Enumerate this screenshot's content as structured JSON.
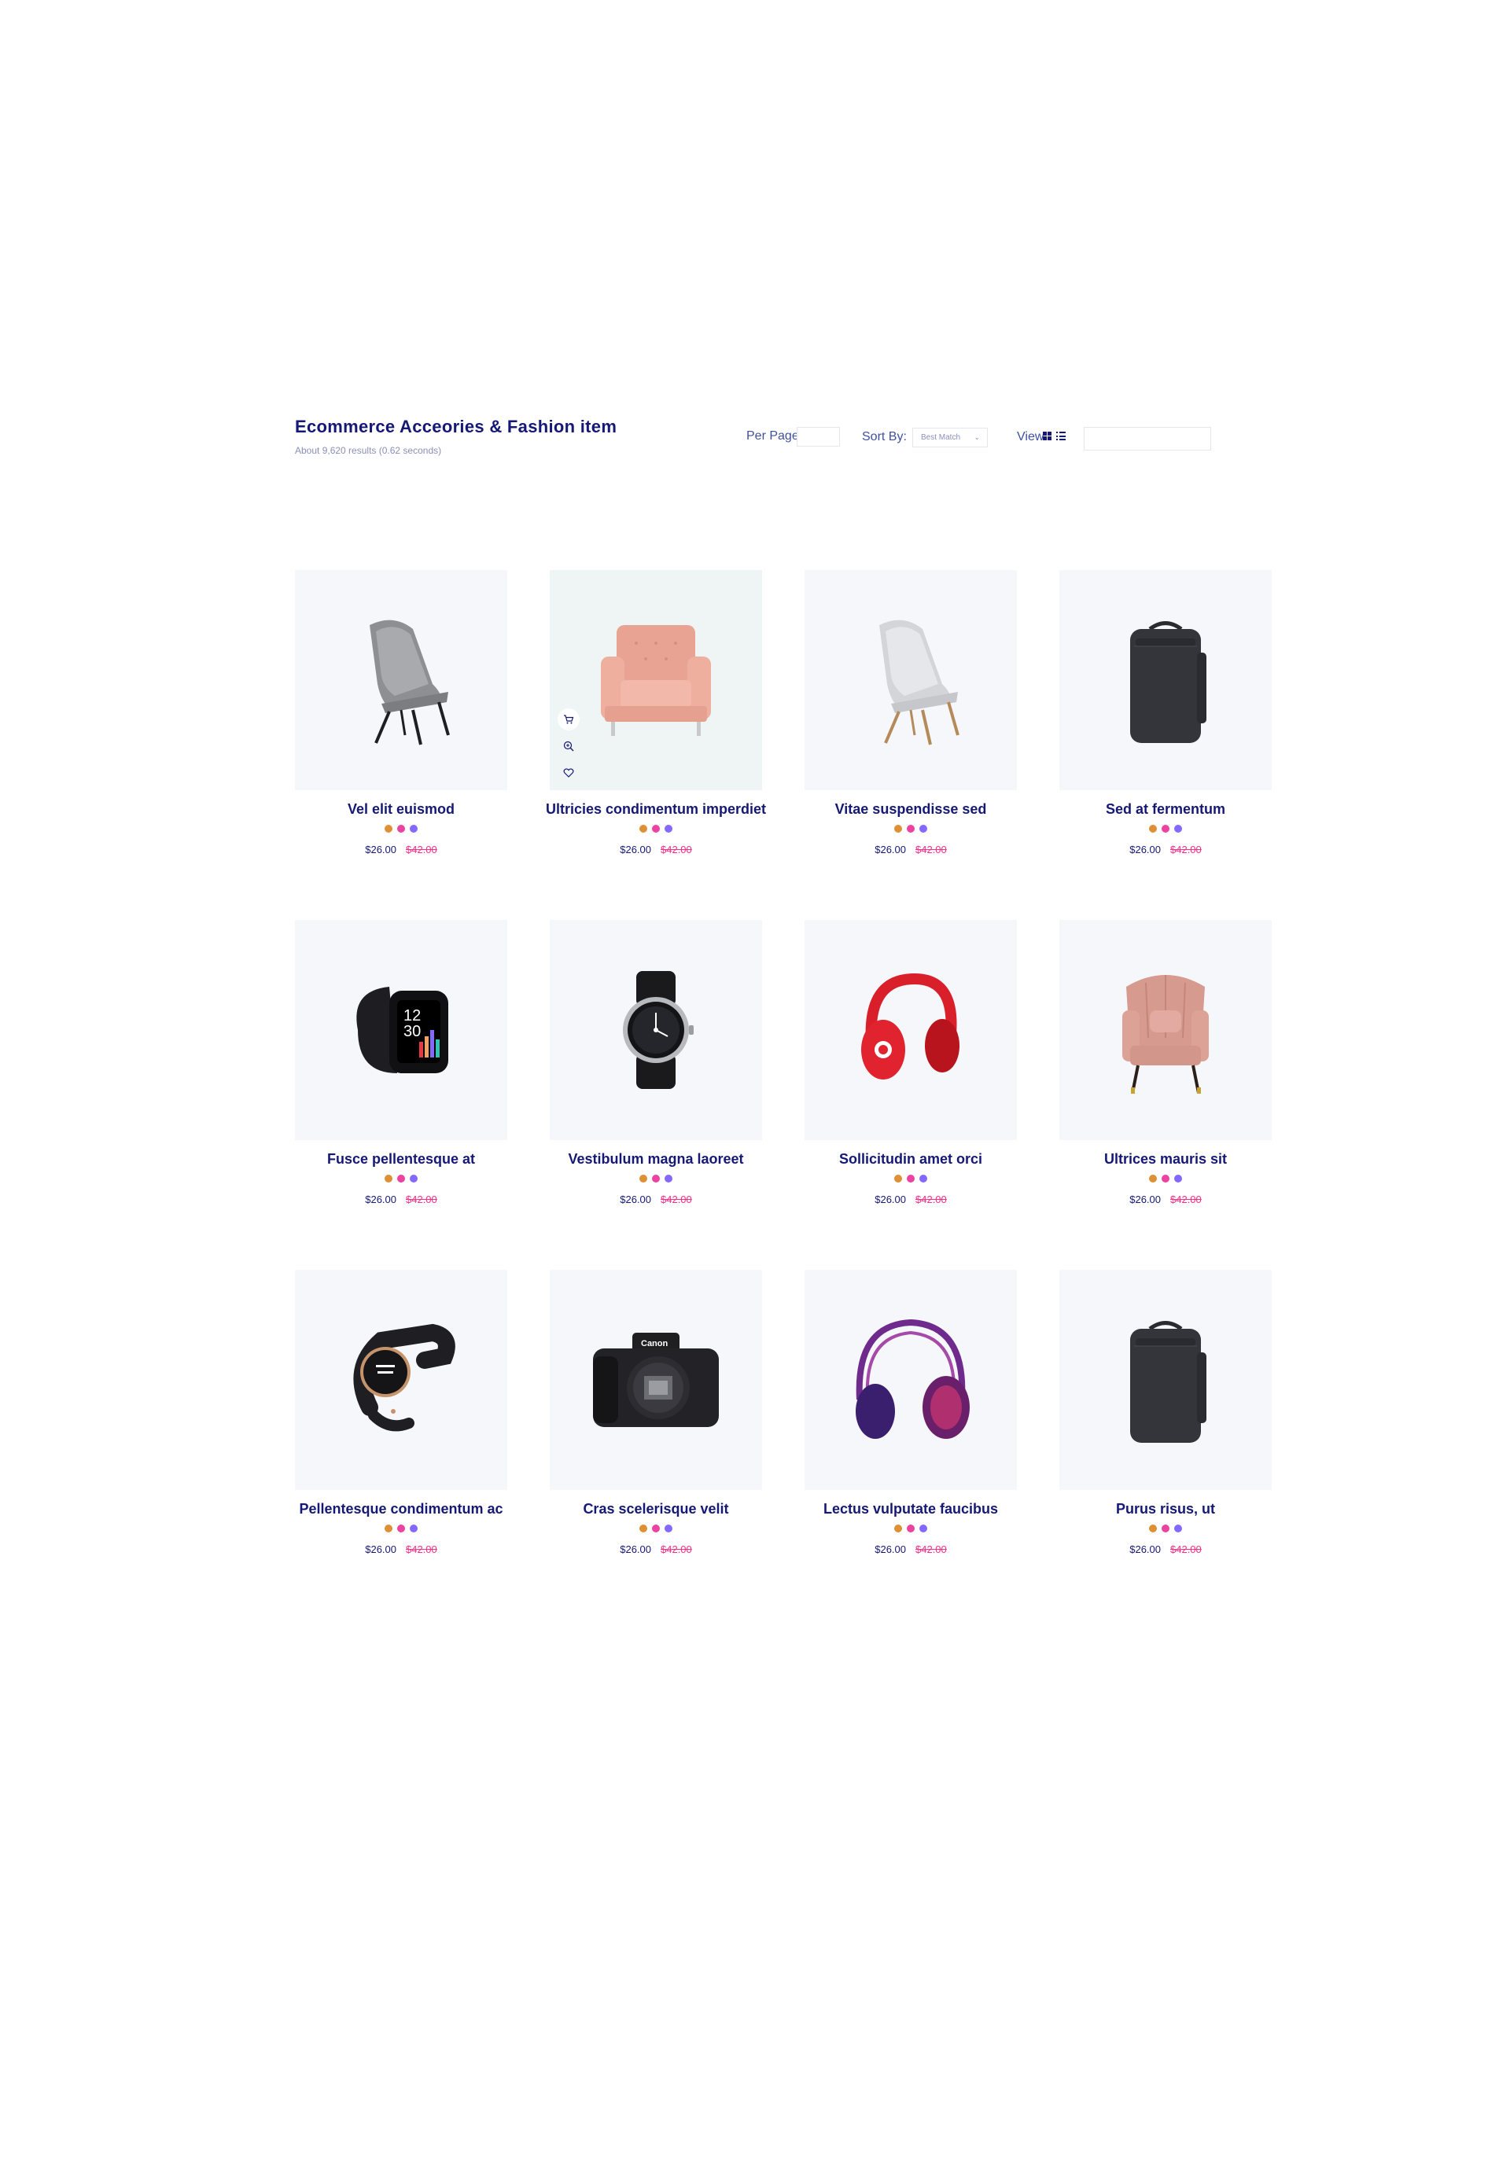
{
  "header": {
    "title": "Ecommerce Acceories & Fashion item",
    "results": "About 9,620 results (0.62 seconds)",
    "per_page_label": "Per Page:",
    "per_page_value": "",
    "sort_label": "Sort By:",
    "sort_value": "Best Match",
    "view_label": "View:",
    "search_value": ""
  },
  "colors": {
    "title": "#151875",
    "accent_pink": "#fb2e86",
    "dot_orange": "#de9034",
    "dot_pink": "#ec42a2",
    "dot_purple": "#8568ff",
    "card_bg": "#f6f7fb"
  },
  "products": [
    {
      "name": "Vel elit euismod",
      "price": "$26.00",
      "old_price": "$42.00",
      "image": "grey-lounge-chair"
    },
    {
      "name": "Ultricies condimentum imperdiet",
      "price": "$26.00",
      "old_price": "$42.00",
      "image": "pink-sofa-chair"
    },
    {
      "name": "Vitae suspendisse sed",
      "price": "$26.00",
      "old_price": "$42.00",
      "image": "white-lounge-chair"
    },
    {
      "name": "Sed at fermentum",
      "price": "$26.00",
      "old_price": "$42.00",
      "image": "black-backpack"
    },
    {
      "name": "Fusce pellentesque at",
      "price": "$26.00",
      "old_price": "$42.00",
      "image": "smartwatch"
    },
    {
      "name": "Vestibulum magna laoreet",
      "price": "$26.00",
      "old_price": "$42.00",
      "image": "round-smartwatch"
    },
    {
      "name": "Sollicitudin amet orci",
      "price": "$26.00",
      "old_price": "$42.00",
      "image": "red-headphones"
    },
    {
      "name": "Ultrices mauris sit",
      "price": "$26.00",
      "old_price": "$42.00",
      "image": "pink-armchair"
    },
    {
      "name": "Pellentesque condimentum ac",
      "price": "$26.00",
      "old_price": "$42.00",
      "image": "fitness-band"
    },
    {
      "name": "Cras scelerisque velit",
      "price": "$26.00",
      "old_price": "$42.00",
      "image": "dslr-camera"
    },
    {
      "name": "Lectus vulputate faucibus",
      "price": "$26.00",
      "old_price": "$42.00",
      "image": "purple-headphones"
    },
    {
      "name": "Purus risus, ut",
      "price": "$26.00",
      "old_price": "$42.00",
      "image": "black-backpack"
    }
  ]
}
